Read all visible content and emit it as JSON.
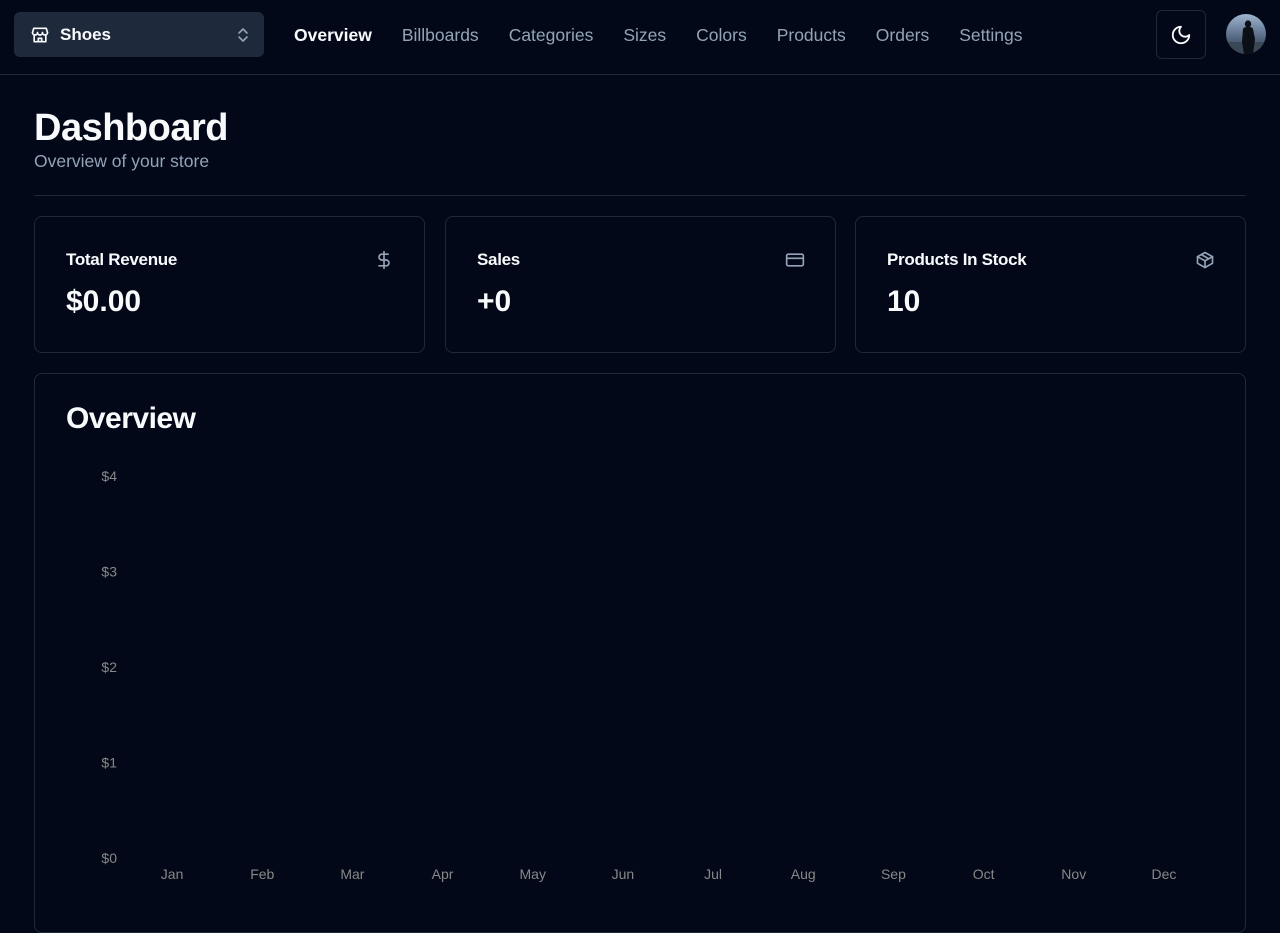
{
  "header": {
    "store_switcher": {
      "label": "Shoes",
      "icon": "store-icon"
    },
    "nav": [
      {
        "label": "Overview",
        "active": true
      },
      {
        "label": "Billboards",
        "active": false
      },
      {
        "label": "Categories",
        "active": false
      },
      {
        "label": "Sizes",
        "active": false
      },
      {
        "label": "Colors",
        "active": false
      },
      {
        "label": "Products",
        "active": false
      },
      {
        "label": "Orders",
        "active": false
      },
      {
        "label": "Settings",
        "active": false
      }
    ],
    "theme_toggle_icon": "moon-icon",
    "avatar": "user-avatar"
  },
  "page": {
    "title": "Dashboard",
    "subtitle": "Overview of your store"
  },
  "cards": [
    {
      "title": "Total Revenue",
      "value": "$0.00",
      "icon": "dollar-icon"
    },
    {
      "title": "Sales",
      "value": "+0",
      "icon": "credit-card-icon"
    },
    {
      "title": "Products In Stock",
      "value": "10",
      "icon": "package-icon"
    }
  ],
  "overview": {
    "title": "Overview"
  },
  "chart_data": {
    "type": "bar",
    "categories": [
      "Jan",
      "Feb",
      "Mar",
      "Apr",
      "May",
      "Jun",
      "Jul",
      "Aug",
      "Sep",
      "Oct",
      "Nov",
      "Dec"
    ],
    "values": [
      0,
      0,
      0,
      0,
      0,
      0,
      0,
      0,
      0,
      0,
      0,
      0
    ],
    "y_ticks": [
      "$0",
      "$1",
      "$2",
      "$3",
      "$4"
    ],
    "ylim": [
      0,
      4
    ],
    "grid": false,
    "colors": {
      "bar": "#3498db",
      "tick_text": "#888888"
    }
  },
  "theme": {
    "background": "#020817",
    "border": "#1e293b",
    "muted_text": "#94a3b8",
    "foreground": "#f8fafc"
  }
}
